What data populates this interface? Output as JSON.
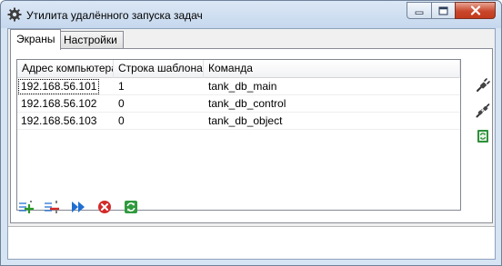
{
  "window": {
    "title": "Утилита удалённого запуска задач"
  },
  "tabs": [
    {
      "label": "Экраны",
      "active": true
    },
    {
      "label": "Настройки",
      "active": false
    }
  ],
  "table": {
    "columns": [
      "Адрес компьютера",
      "Строка шаблона",
      "Команда"
    ],
    "rows": [
      {
        "address": "192.168.56.101",
        "template_line": "1",
        "command": "tank_db_main"
      },
      {
        "address": "192.168.56.102",
        "template_line": "0",
        "command": "tank_db_control"
      },
      {
        "address": "192.168.56.103",
        "template_line": "0",
        "command": "tank_db_object"
      }
    ]
  },
  "side_tools": [
    "connect-plug-icon",
    "disconnect-plug-icon",
    "excel-refresh-icon"
  ],
  "bottom_tools": [
    "add-row-icon",
    "remove-row-icon",
    "fast-forward-icon",
    "stop-icon",
    "refresh-icon"
  ],
  "status": {
    "text": ""
  },
  "colors": {
    "accent_blue": "#1f6fd0",
    "stop_red": "#d42a2a",
    "add_green": "#2a9a2a",
    "close_red": "#c9472d"
  }
}
